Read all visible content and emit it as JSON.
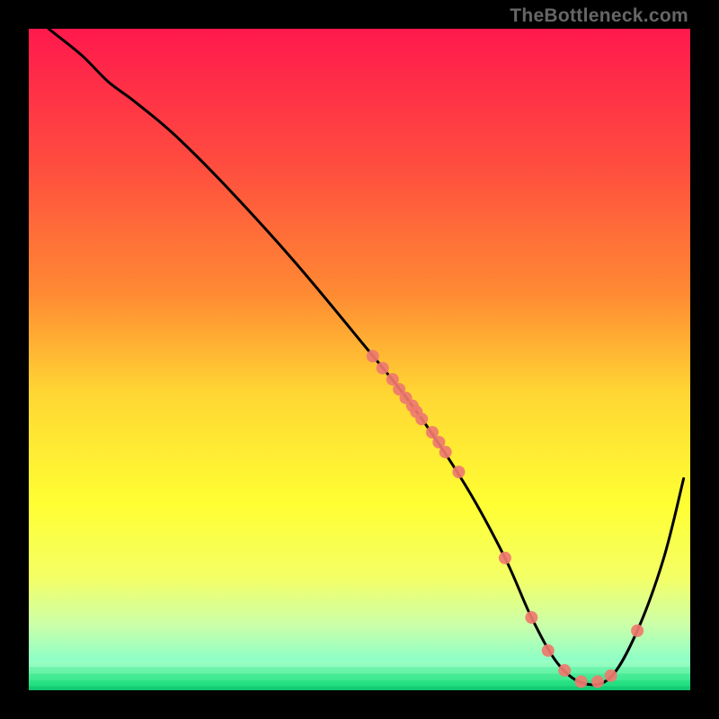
{
  "attribution": "TheBottleneck.com",
  "chart_data": {
    "type": "line",
    "title": "",
    "xlabel": "",
    "ylabel": "",
    "xlim": [
      0,
      100
    ],
    "ylim": [
      0,
      100
    ],
    "grid": false,
    "legend": false,
    "background": {
      "type": "vertical-gradient",
      "stops": [
        {
          "pos": 0.0,
          "color": "#ff194d"
        },
        {
          "pos": 0.2,
          "color": "#ff4b3f"
        },
        {
          "pos": 0.4,
          "color": "#ff8a33"
        },
        {
          "pos": 0.55,
          "color": "#ffd633"
        },
        {
          "pos": 0.72,
          "color": "#ffff33"
        },
        {
          "pos": 0.83,
          "color": "#f4ff66"
        },
        {
          "pos": 0.9,
          "color": "#ccffa8"
        },
        {
          "pos": 0.955,
          "color": "#8dffc7"
        },
        {
          "pos": 1.0,
          "color": "#14e07a"
        }
      ]
    },
    "series": [
      {
        "name": "bottleneck-curve",
        "type": "line",
        "color": "#000000",
        "x": [
          3,
          8,
          12,
          16,
          22,
          30,
          40,
          50,
          58,
          66,
          72,
          76,
          80,
          84,
          88,
          92,
          96,
          99
        ],
        "y": [
          100,
          96,
          92,
          89,
          84,
          76,
          65,
          53,
          43,
          31,
          20,
          11,
          4,
          1,
          2,
          9,
          20,
          32
        ]
      },
      {
        "name": "highlight-points",
        "type": "scatter",
        "color": "#ef7a6f",
        "x": [
          52,
          53.5,
          55,
          56,
          57,
          58,
          58.6,
          59.4,
          61,
          62,
          63,
          65,
          72,
          76,
          78.5,
          81,
          83.5,
          86,
          88,
          92
        ],
        "y": [
          50.5,
          48.7,
          47,
          45.5,
          44.2,
          43,
          42.1,
          41,
          39,
          37.5,
          36,
          33,
          20,
          11,
          6,
          3,
          1.3,
          1.3,
          2.2,
          9
        ]
      }
    ]
  }
}
